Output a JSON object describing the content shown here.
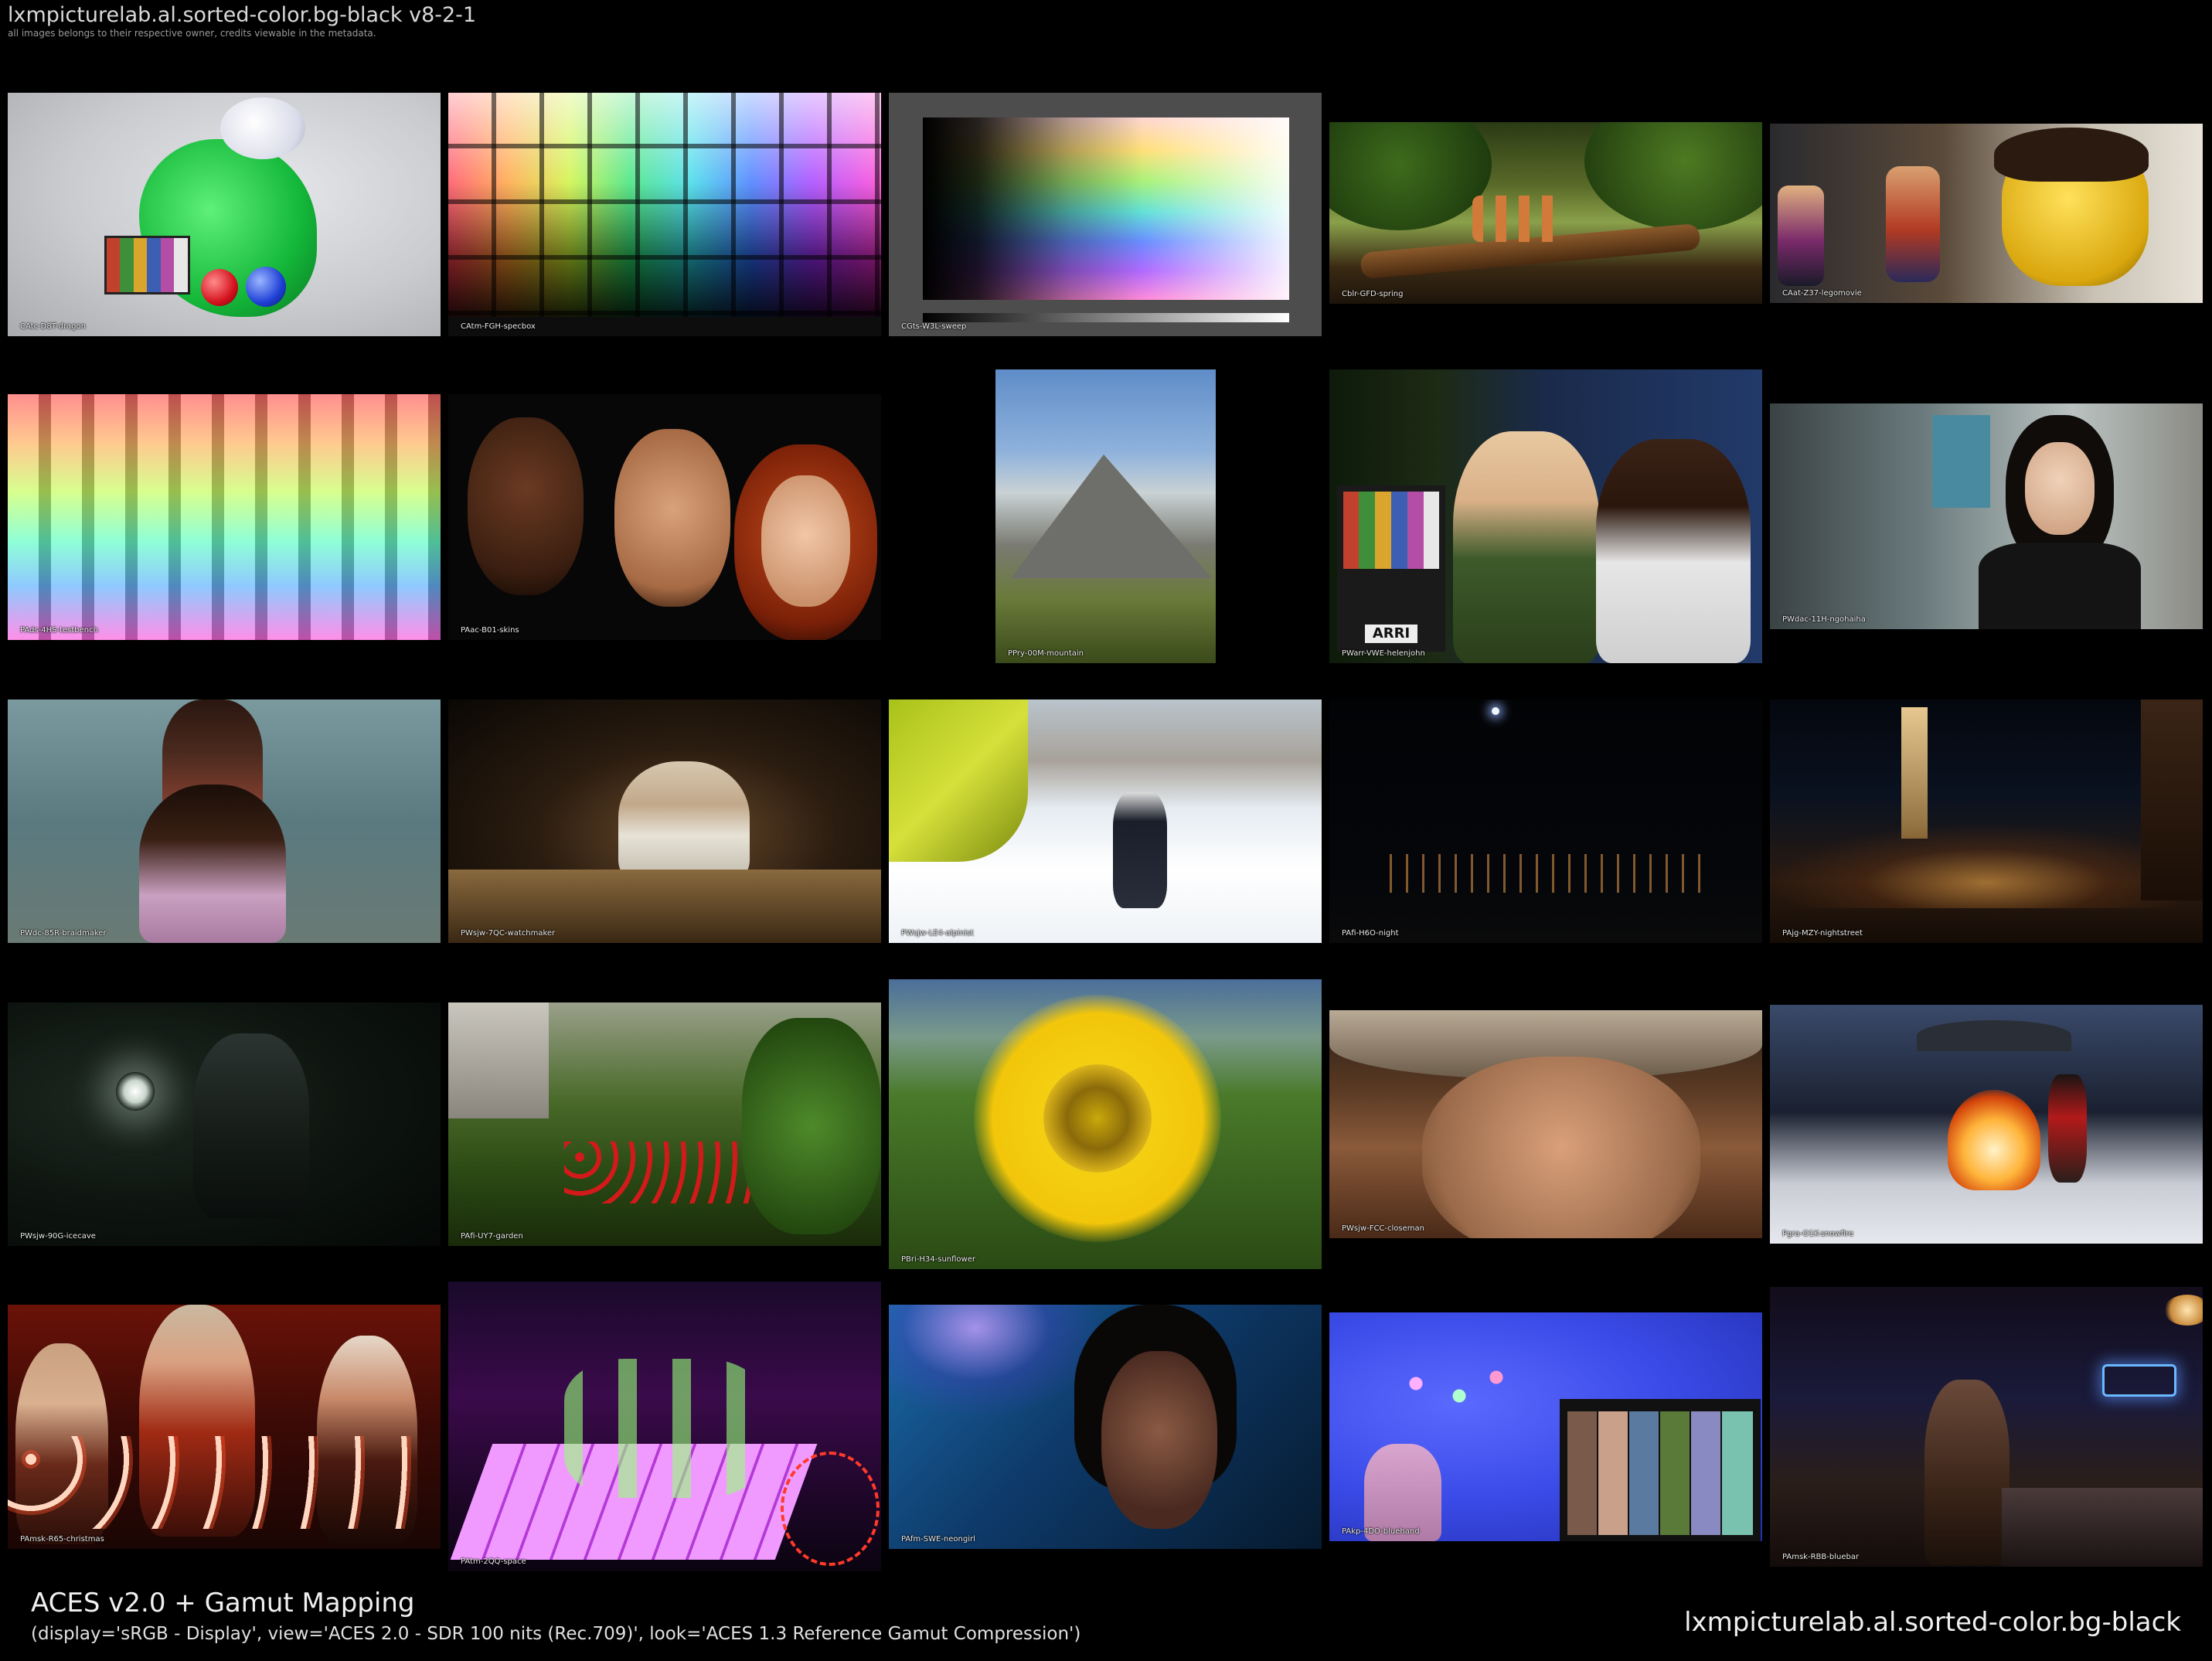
{
  "page": {
    "title": "lxmpicturelab.al.sorted-color.bg-black v8-2-1",
    "credits": "all images belongs to their respective owner, credits viewable in the metadata."
  },
  "footer": {
    "title": "ACES v2.0 + Gamut Mapping",
    "params": "(display='sRGB - Display', view='ACES 2.0 - SDR 100 nits (Rec.709)', look='ACES 1.3 Reference Gamut Compression')",
    "set_name": "lxmpicturelab.al.sorted-color.bg-black"
  },
  "tiles": [
    {
      "label": "CAtc-D8T-dragon"
    },
    {
      "label": "CAtm-FGH-specbox"
    },
    {
      "label": "CGts-W3L-sweep"
    },
    {
      "label": "Cblr-GFD-spring"
    },
    {
      "label": "CAat-Z37-legomovie"
    },
    {
      "label": "PAds-4HS-testbench"
    },
    {
      "label": "PAac-B01-skins"
    },
    {
      "label": "PPry-00M-mountain"
    },
    {
      "label": "PWarr-VWE-helenjohn"
    },
    {
      "label": "PWdac-11H-ngohaiha"
    },
    {
      "label": "PWdc-85R-braidmaker"
    },
    {
      "label": "PWsjw-7QC-watchmaker"
    },
    {
      "label": "PWsjw-LE4-alpinist"
    },
    {
      "label": "PAfi-H6O-night"
    },
    {
      "label": "PAjg-MZY-nightstreet"
    },
    {
      "label": "PWsjw-90G-icecave"
    },
    {
      "label": "PAfi-UY7-garden"
    },
    {
      "label": "PBri-H34-sunflower"
    },
    {
      "label": "PWsjw-FCC-closeman"
    },
    {
      "label": "Pgra-O1K-snowfire"
    },
    {
      "label": "PAmsk-R65-christmas"
    },
    {
      "label": "PAtm-2QQ-space"
    },
    {
      "label": "PAfm-SWE-neongirl"
    },
    {
      "label": "PAkp-4DO-bluehand"
    },
    {
      "label": "PAmsk-RBB-bluebar"
    }
  ]
}
